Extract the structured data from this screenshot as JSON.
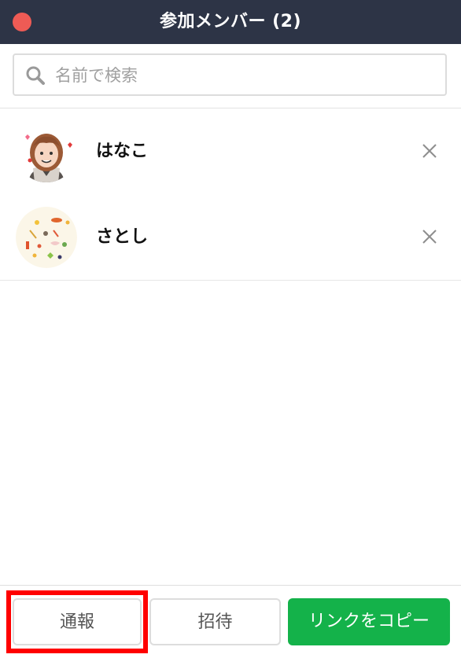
{
  "window": {
    "title": "参加メンバー (2)"
  },
  "search": {
    "placeholder": "名前で検索",
    "value": ""
  },
  "members": [
    {
      "name": "はなこ"
    },
    {
      "name": "さとし"
    }
  ],
  "footer": {
    "report_label": "通報",
    "invite_label": "招待",
    "copy_link_label": "リンクをコピー"
  },
  "colors": {
    "titlebar": "#2d3446",
    "close": "#ee5b55",
    "primary_button": "#14b24a",
    "highlight": "#ff0000"
  }
}
